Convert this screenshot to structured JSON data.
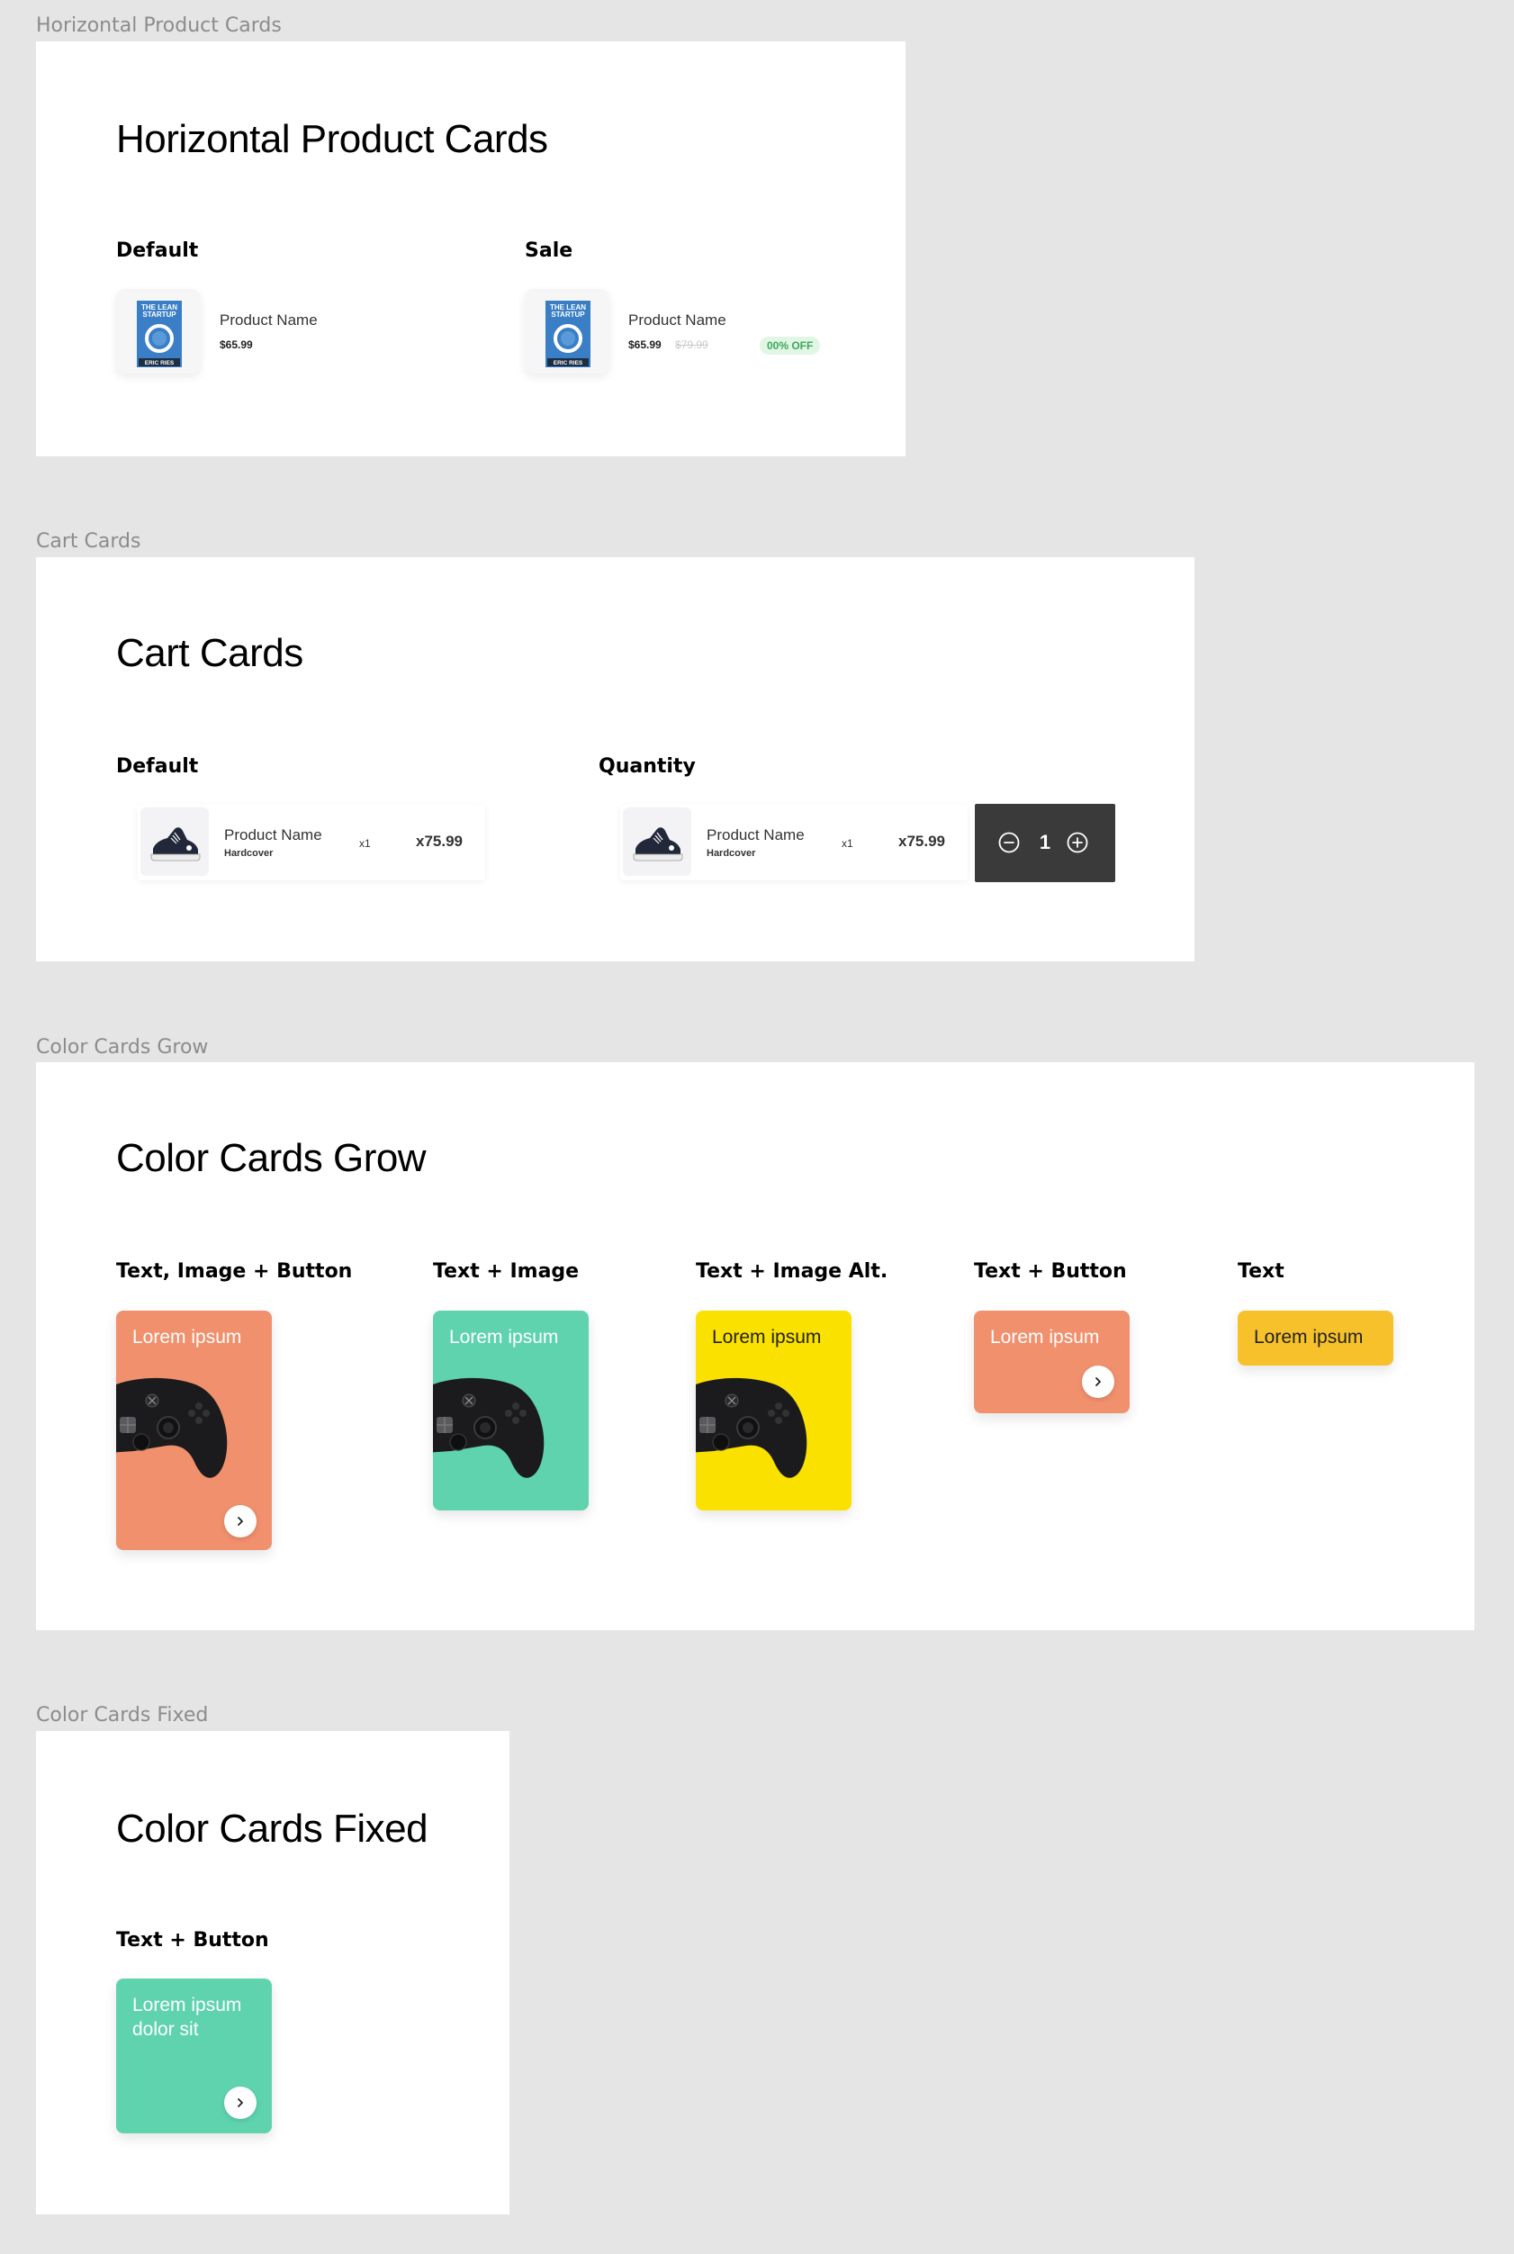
{
  "frames": {
    "horizontal": {
      "label": "Horizontal Product Cards",
      "title": "Horizontal Product Cards",
      "default_label": "Default",
      "sale_label": "Sale",
      "default_card": {
        "name": "Product Name",
        "price": "$65.99"
      },
      "sale_card": {
        "name": "Product Name",
        "price": "$65.99",
        "old_price": "$79.99",
        "badge": "00% OFF"
      },
      "book_cover": {
        "line1": "THE LEAN",
        "line2": "STARTUP",
        "author": "ERIC RIES"
      }
    },
    "cart": {
      "label": "Cart Cards",
      "title": "Cart Cards",
      "default_label": "Default",
      "quantity_label": "Quantity",
      "card": {
        "name": "Product Name",
        "sub": "Hardcover",
        "qty": "x1",
        "total": "x75.99"
      },
      "stepper_value": "1"
    },
    "grow": {
      "label": "Color Cards Grow",
      "title": "Color Cards Grow",
      "variants": [
        {
          "label": "Text, Image + Button",
          "text": "Lorem ipsum",
          "color": "#F0906D"
        },
        {
          "label": "Text + Image",
          "text": "Lorem ipsum",
          "color": "#5FD3AE"
        },
        {
          "label": "Text + Image Alt.",
          "text": "Lorem ipsum",
          "color": "#FAE100"
        },
        {
          "label": "Text + Button",
          "text": "Lorem ipsum",
          "color": "#F0906D"
        },
        {
          "label": "Text",
          "text": "Lorem ipsum",
          "color": "#F6C12A"
        }
      ]
    },
    "fixed": {
      "label": "Color Cards Fixed",
      "title": "Color Cards Fixed",
      "variant_label": "Text + Button",
      "text_line1": "Lorem ipsum",
      "text_line2": "dolor sit",
      "color": "#5FD3AE"
    }
  },
  "icons": [
    "book-cover-image",
    "sneaker-image",
    "controller-image",
    "chevron-right-icon",
    "minus-circle-icon",
    "plus-circle-icon"
  ]
}
